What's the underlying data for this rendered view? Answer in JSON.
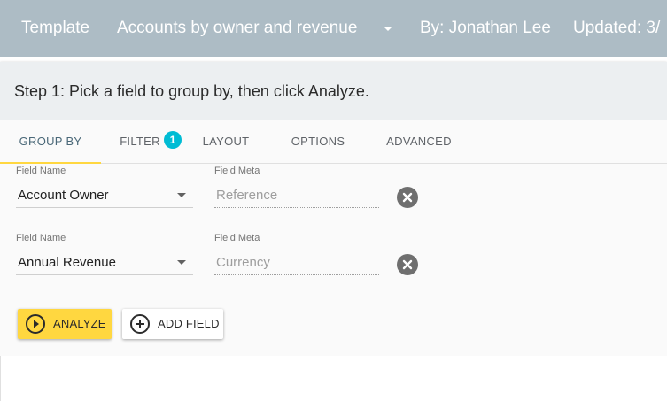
{
  "header": {
    "template_label": "Template",
    "template_value": "Accounts by owner and revenue",
    "author": "By: Jonathan Lee",
    "updated": "Updated: 3/"
  },
  "step": {
    "instruction": "Step 1: Pick a field to group by, then click Analyze."
  },
  "tabs": [
    {
      "label": "GROUP BY",
      "active": true
    },
    {
      "label": "FILTER",
      "badge": "1"
    },
    {
      "label": "LAYOUT"
    },
    {
      "label": "OPTIONS"
    },
    {
      "label": "ADVANCED"
    }
  ],
  "fields": [
    {
      "name_label": "Field Name",
      "name_value": "Account Owner",
      "meta_label": "Field Meta",
      "meta_value": "Reference",
      "clear_icon": "close-circle-icon"
    },
    {
      "name_label": "Field Name",
      "name_value": "Annual Revenue",
      "meta_label": "Field Meta",
      "meta_value": "Currency",
      "clear_icon": "close-circle-icon"
    }
  ],
  "actions": {
    "analyze_label": "ANALYZE",
    "analyze_icon": "play-circle-icon",
    "add_field_label": "ADD FIELD",
    "add_field_icon": "add-circle-icon"
  },
  "colors": {
    "header_bg": "#adbcc5",
    "accent_yellow": "#ffd740",
    "badge_cyan": "#00bcd4"
  }
}
